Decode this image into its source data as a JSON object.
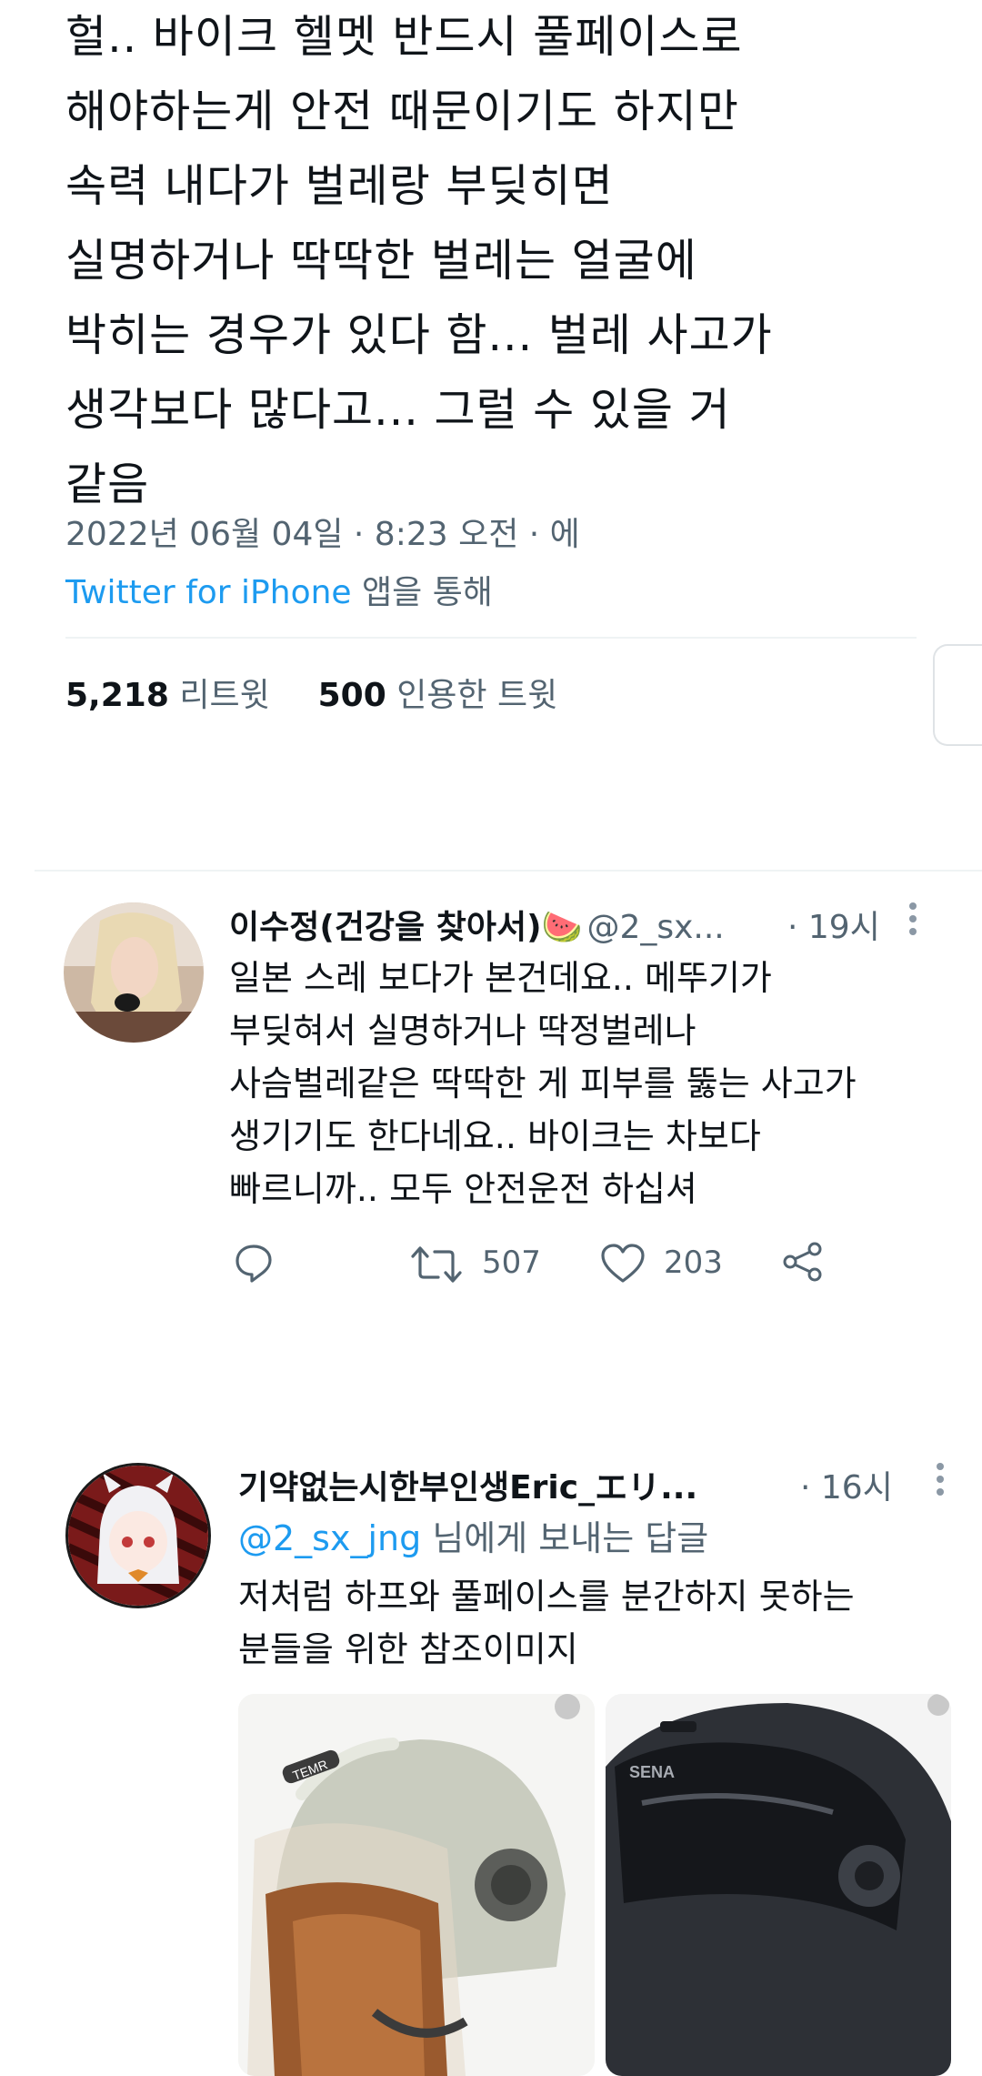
{
  "tweet": {
    "lines": [
      "헐.. 바이크 헬멧 반드시 풀페이스로",
      "해야하는게 안전 때문이기도 하지만",
      "속력 내다가 벌레랑 부딪히면",
      "실명하거나 딱딱한 벌레는 얼굴에",
      "박히는 경우가 있다 함... 벌레 사고가",
      "생각보다 많다고... 그럴 수 있을 거",
      "같음"
    ],
    "datetime": "2022년 06월 04일 · 8:23 오전 · 에",
    "via_source": "Twitter for iPhone",
    "via_suffix": " 앱을 통해",
    "retweet_count": "5,218",
    "retweet_label": "리트윗",
    "quote_count": "500",
    "quote_label": "인용한 트윗"
  },
  "replies": [
    {
      "name": "이수정(건강을 찾아서)🍉",
      "handle": "@2_sx...",
      "time": "· 19시",
      "body_lines": [
        "일본 스레 보다가 본건데요.. 메뚜기가",
        "부딪혀서 실명하거나 딱정벌레나",
        "사슴벌레같은 딱딱한 게 피부를 뚫는 사고가",
        "생기기도 한다네요.. 바이크는 차보다",
        "빠르니까.. 모두 안전운전 하십셔"
      ],
      "retweets": "507",
      "likes": "203"
    },
    {
      "name": "기약없는시한부인생Eric_エリ...",
      "time": "· 16시",
      "reply_to_handle": "@2_sx_jng",
      "reply_to_suffix": " 님에게 보내는 답글",
      "body_lines": [
        "저처럼 하프와 풀페이스를 분간하지 못하는",
        "분들을 위한 참조이미지"
      ],
      "helmet_brand": "TEMR",
      "helmet2_brand": "SENA"
    }
  ],
  "colors": {
    "accent": "#1d9bf0",
    "muted": "#536471",
    "text": "#0f1419"
  }
}
